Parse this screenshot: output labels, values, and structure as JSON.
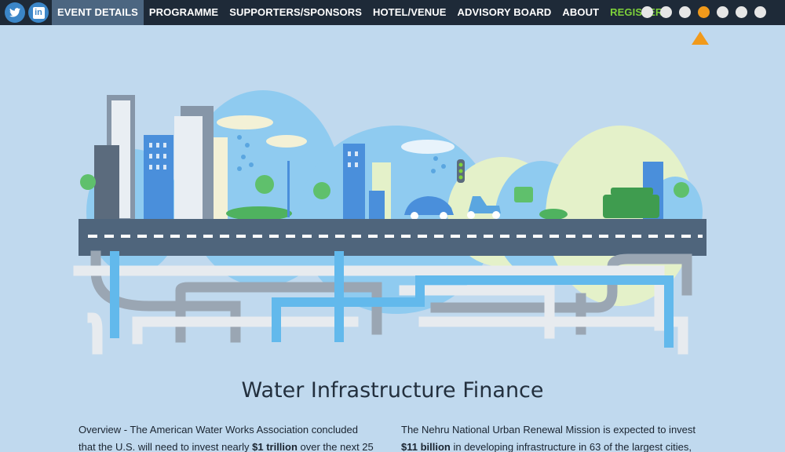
{
  "nav": {
    "social": [
      {
        "name": "twitter",
        "icon": "twitter-icon"
      },
      {
        "name": "linkedin",
        "icon": "linkedin-icon",
        "glyph": "in"
      }
    ],
    "items": [
      {
        "label": "EVENT DETAILS",
        "active": true
      },
      {
        "label": "PROGRAMME"
      },
      {
        "label": "SUPPORTERS/SPONSORS"
      },
      {
        "label": "HOTEL/VENUE"
      },
      {
        "label": "ADVISORY BOARD"
      },
      {
        "label": "ABOUT"
      },
      {
        "label": "REGISTER",
        "highlight": true
      }
    ],
    "slide_dots": {
      "count": 7,
      "active_index": 3
    },
    "colors": {
      "bar": "#1e2a38",
      "active_bg": "#4c6681",
      "register": "#7ed23a",
      "accent": "#f19a1b"
    }
  },
  "main": {
    "title": "Water Infrastructure Finance",
    "left": {
      "line1": "Overview - The American Water Works Association concluded",
      "line2_pre": "that the U.S. will need to invest nearly ",
      "line2_bold": "$1 trillion",
      "line2_post": " over the next 25"
    },
    "right": {
      "line1": "The Nehru National Urban Renewal Mission is expected to invest",
      "line2_bold": "$11 billion",
      "line2_post": " in developing infrastructure in 63 of the largest cities,"
    }
  }
}
